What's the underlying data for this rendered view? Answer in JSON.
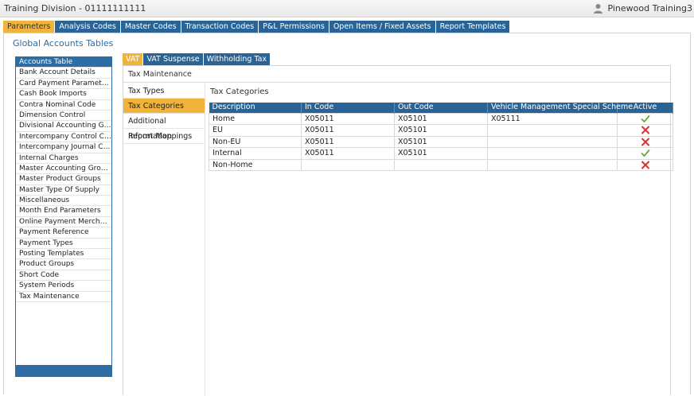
{
  "window": {
    "title": "Training Division - 01111111111",
    "user_name": "Pinewood Training3"
  },
  "main_tabs": [
    {
      "label": "Parameters",
      "active": true
    },
    {
      "label": "Analysis Codes",
      "active": false
    },
    {
      "label": "Master Codes",
      "active": false
    },
    {
      "label": "Transaction Codes",
      "active": false
    },
    {
      "label": "P&L Permissions",
      "active": false
    },
    {
      "label": "Open Items / Fixed Assets",
      "active": false
    },
    {
      "label": "Report Templates",
      "active": false
    }
  ],
  "section_title": "Global Accounts Tables",
  "left_list": [
    "Accounts Table",
    "Bank Account Details",
    "Card Payment Parameters",
    "Cash Book Imports",
    "Contra Nominal Code",
    "Dimension Control",
    "Divisional Accounting Gro...",
    "Intercompany Control Co...",
    "Intercompany Journal Co...",
    "Internal Charges",
    "Master Accounting Groups",
    "Master Product Groups",
    "Master Type Of Supply",
    "Miscellaneous",
    "Month End Parameters",
    "Online Payment Merchants",
    "Payment Reference",
    "Payment Types",
    "Posting Templates",
    "Product Groups",
    "Short Code",
    "System Periods",
    "Tax Maintenance"
  ],
  "sub_tabs": [
    {
      "label": "VAT",
      "active": true
    },
    {
      "label": "VAT Suspense",
      "active": false
    },
    {
      "label": "Withholding Tax",
      "active": false
    }
  ],
  "tax_maintenance_title": "Tax Maintenance",
  "inner_nav": [
    {
      "label": "Tax Types",
      "active": false
    },
    {
      "label": "Tax Categories",
      "active": true
    },
    {
      "label": "Additional Information",
      "active": false
    },
    {
      "label": "Report Mappings",
      "active": false
    }
  ],
  "tax_categories": {
    "label": "Tax Categories",
    "columns": [
      "Description",
      "In Code",
      "Out Code",
      "Vehicle Management Special Scheme",
      "Active"
    ],
    "rows": [
      {
        "description": "Home",
        "in_code": "X05011",
        "out_code": "X05101",
        "vmss": "X05111",
        "active": true
      },
      {
        "description": "EU",
        "in_code": "X05011",
        "out_code": "X05101",
        "vmss": "",
        "active": false
      },
      {
        "description": "Non-EU",
        "in_code": "X05011",
        "out_code": "X05101",
        "vmss": "",
        "active": false
      },
      {
        "description": "Internal",
        "in_code": "X05011",
        "out_code": "X05101",
        "vmss": "",
        "active": true
      },
      {
        "description": "Non-Home",
        "in_code": "",
        "out_code": "",
        "vmss": "",
        "active": false
      }
    ]
  },
  "colors": {
    "tab_blue": "#2a6496",
    "active_orange": "#f0b43c",
    "check_green": "#6aa83a",
    "cross_red": "#d9312b"
  },
  "icons": {
    "user": "user-icon",
    "active_true": "check-icon",
    "active_false": "cross-icon"
  }
}
